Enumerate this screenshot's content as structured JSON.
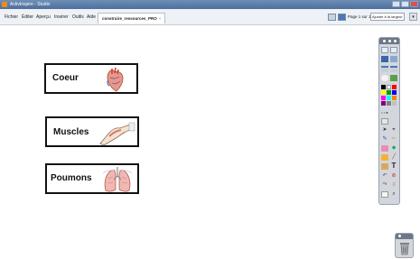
{
  "window": {
    "title": "ActivInspire - Studio"
  },
  "menu": {
    "items": [
      "Fichier",
      "Éditer",
      "Aperçu",
      "Insérer",
      "Outils",
      "Aide"
    ]
  },
  "document_tab": {
    "label": "construire_ressources_PRO",
    "close": "×"
  },
  "page_nav": {
    "label": "Page 1 sur 1",
    "zoom": "Ajuster à la largeur",
    "dropdown": "▾"
  },
  "cards": [
    {
      "label": "Coeur",
      "image": "heart-image"
    },
    {
      "label": "Muscles",
      "image": "arm-muscle-image"
    },
    {
      "label": "Poumons",
      "image": "lungs-image"
    }
  ],
  "toolbox": {
    "colors": [
      "#000000",
      "#ffffff",
      "#ff0000",
      "#ffff00",
      "#00a000",
      "#0000ff",
      "#ff00ff",
      "#00ffff",
      "#ff8000",
      "#800080",
      "#808080",
      "#c0c0c0"
    ],
    "tools": [
      "select-tool-icon",
      "marquee-tool-icon",
      "pen-tool-icon",
      "highlighter-tool-icon",
      "eraser-tool-icon",
      "fill-tool-icon",
      "shape-tool-icon",
      "text-tool-icon",
      "undo-icon",
      "redo-icon",
      "delete-icon",
      "clear-icon",
      "page-browser-icon",
      "zoom-icon"
    ],
    "text_tool_glyph": "T"
  },
  "trash": {
    "icon": "trash-icon"
  }
}
